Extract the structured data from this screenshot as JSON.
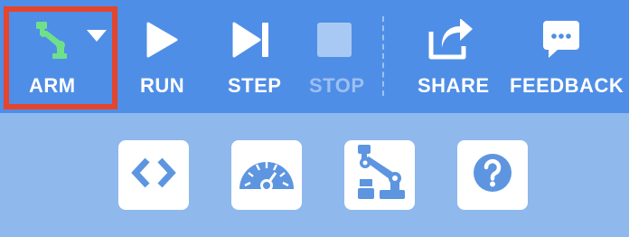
{
  "toolbar": {
    "arm": {
      "label": "ARM",
      "icon": "robot-arm-icon",
      "menu_icon": "caret-down-icon"
    },
    "run": {
      "label": "RUN",
      "icon": "play-icon"
    },
    "step": {
      "label": "STEP",
      "icon": "step-forward-icon"
    },
    "stop": {
      "label": "STOP",
      "icon": "stop-icon",
      "disabled": true
    },
    "share": {
      "label": "SHARE",
      "icon": "share-icon"
    },
    "feedback": {
      "label": "FEEDBACK",
      "icon": "chat-bubble-icon"
    }
  },
  "panel": {
    "tiles": [
      {
        "icon": "code-brackets-icon"
      },
      {
        "icon": "speedometer-icon"
      },
      {
        "icon": "robot-arm-icon"
      },
      {
        "icon": "help-icon"
      }
    ]
  },
  "colors": {
    "toolbar_bg": "#4f8ee6",
    "panel_bg": "#8fb8ec",
    "selection_border": "#e5452d",
    "arm_accent": "#6ee08a",
    "tile_icon": "#5d95e0",
    "disabled_text": "#9bbff2"
  }
}
